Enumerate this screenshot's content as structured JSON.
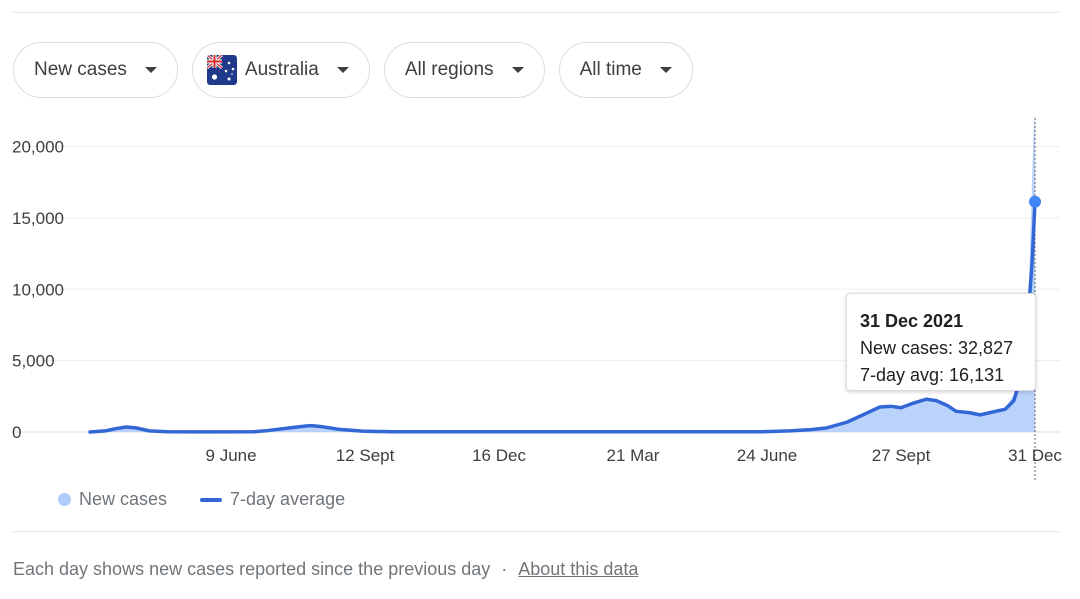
{
  "filters": [
    {
      "label": "New cases",
      "icon": "chevron-down-icon"
    },
    {
      "label": "Australia",
      "icon": "chevron-down-icon",
      "flag_icon": "australia-flag-icon"
    },
    {
      "label": "All regions",
      "icon": "chevron-down-icon"
    },
    {
      "label": "All time",
      "icon": "chevron-down-icon"
    }
  ],
  "chart_data": {
    "type": "area",
    "x_axis_type": "date",
    "x_start": "2020-03-01",
    "x_end": "2021-12-31",
    "xticks": [
      {
        "date": "2020-06-09",
        "label": "9 June"
      },
      {
        "date": "2020-09-12",
        "label": "12 Sept"
      },
      {
        "date": "2020-12-16",
        "label": "16 Dec"
      },
      {
        "date": "2021-03-21",
        "label": "21 Mar"
      },
      {
        "date": "2021-06-24",
        "label": "24 June"
      },
      {
        "date": "2021-09-27",
        "label": "27 Sept"
      },
      {
        "date": "2021-12-31",
        "label": "31 Dec"
      }
    ],
    "ylim": [
      0,
      22000
    ],
    "yticks": [
      0,
      5000,
      10000,
      15000,
      20000
    ],
    "ytick_labels": [
      "0",
      "5,000",
      "10,000",
      "15,000",
      "20,000"
    ],
    "grid": true,
    "series": [
      {
        "name": "7-day average",
        "kind": "line",
        "color": "#3367d6",
        "points": [
          [
            "2020-03-01",
            0
          ],
          [
            "2020-03-12",
            80
          ],
          [
            "2020-03-20",
            250
          ],
          [
            "2020-03-27",
            350
          ],
          [
            "2020-04-03",
            280
          ],
          [
            "2020-04-12",
            80
          ],
          [
            "2020-04-25",
            20
          ],
          [
            "2020-05-20",
            10
          ],
          [
            "2020-06-25",
            15
          ],
          [
            "2020-07-05",
            100
          ],
          [
            "2020-07-20",
            280
          ],
          [
            "2020-08-01",
            420
          ],
          [
            "2020-08-05",
            450
          ],
          [
            "2020-08-12",
            380
          ],
          [
            "2020-08-25",
            180
          ],
          [
            "2020-09-10",
            60
          ],
          [
            "2020-10-01",
            15
          ],
          [
            "2021-06-20",
            15
          ],
          [
            "2021-07-10",
            80
          ],
          [
            "2021-07-25",
            170
          ],
          [
            "2021-08-05",
            280
          ],
          [
            "2021-08-20",
            700
          ],
          [
            "2021-09-01",
            1250
          ],
          [
            "2021-09-12",
            1750
          ],
          [
            "2021-09-20",
            1800
          ],
          [
            "2021-09-27",
            1700
          ],
          [
            "2021-10-05",
            2000
          ],
          [
            "2021-10-15",
            2300
          ],
          [
            "2021-10-22",
            2200
          ],
          [
            "2021-10-30",
            1850
          ],
          [
            "2021-11-05",
            1450
          ],
          [
            "2021-11-15",
            1350
          ],
          [
            "2021-11-22",
            1200
          ],
          [
            "2021-12-01",
            1400
          ],
          [
            "2021-12-10",
            1600
          ],
          [
            "2021-12-16",
            2200
          ],
          [
            "2021-12-20",
            3500
          ],
          [
            "2021-12-24",
            6000
          ],
          [
            "2021-12-27",
            9200
          ],
          [
            "2021-12-29",
            12000
          ],
          [
            "2021-12-31",
            16131
          ]
        ]
      },
      {
        "name": "New cases",
        "kind": "area",
        "color": "#aecbfa",
        "points": [
          [
            "2020-03-01",
            0
          ],
          [
            "2020-03-12",
            80
          ],
          [
            "2020-03-20",
            250
          ],
          [
            "2020-03-27",
            380
          ],
          [
            "2020-04-03",
            280
          ],
          [
            "2020-04-12",
            80
          ],
          [
            "2020-04-25",
            20
          ],
          [
            "2020-05-20",
            10
          ],
          [
            "2020-06-25",
            15
          ],
          [
            "2020-07-05",
            100
          ],
          [
            "2020-07-20",
            280
          ],
          [
            "2020-08-01",
            430
          ],
          [
            "2020-08-05",
            470
          ],
          [
            "2020-08-12",
            380
          ],
          [
            "2020-08-25",
            180
          ],
          [
            "2020-09-10",
            60
          ],
          [
            "2020-10-01",
            15
          ],
          [
            "2021-06-20",
            15
          ],
          [
            "2021-07-10",
            80
          ],
          [
            "2021-07-25",
            170
          ],
          [
            "2021-08-05",
            280
          ],
          [
            "2021-08-20",
            700
          ],
          [
            "2021-09-01",
            1250
          ],
          [
            "2021-09-12",
            1800
          ],
          [
            "2021-09-20",
            1850
          ],
          [
            "2021-09-27",
            1700
          ],
          [
            "2021-10-05",
            2050
          ],
          [
            "2021-10-15",
            2350
          ],
          [
            "2021-10-22",
            2250
          ],
          [
            "2021-10-30",
            1850
          ],
          [
            "2021-11-05",
            1450
          ],
          [
            "2021-11-15",
            1350
          ],
          [
            "2021-11-22",
            1200
          ],
          [
            "2021-12-01",
            1400
          ],
          [
            "2021-12-10",
            1700
          ],
          [
            "2021-12-16",
            2600
          ],
          [
            "2021-12-20",
            4000
          ],
          [
            "2021-12-24",
            7000
          ],
          [
            "2021-12-27",
            11000
          ],
          [
            "2021-12-29",
            18000
          ],
          [
            "2021-12-30",
            21000
          ],
          [
            "2021-12-31",
            32827
          ]
        ]
      }
    ],
    "highlight": {
      "date": "2021-12-31",
      "value": 16131
    },
    "legend": {
      "placement": "bottom-left",
      "items": [
        "New cases",
        "7-day average"
      ]
    }
  },
  "tooltip": {
    "date": "31 Dec 2021",
    "new_cases": "New cases: 32,827",
    "avg": "7-day avg: 16,131"
  },
  "legend": {
    "new_cases": "New cases",
    "avg": "7-day average"
  },
  "footer": {
    "note": "Each day shows new cases reported since the previous day",
    "separator": "·",
    "link": "About this data"
  }
}
